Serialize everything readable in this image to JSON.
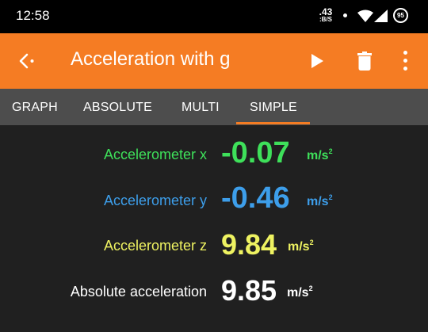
{
  "status_bar": {
    "time": "12:58",
    "net_speed_value": ".43",
    "net_speed_unit": ":B/S",
    "battery_level": "95",
    "icons": [
      "notification-dot-icon",
      "wifi-icon",
      "cell-signal-icon",
      "battery-icon"
    ]
  },
  "app_bar": {
    "title": "Acceleration with g",
    "background_color": "#f57c23",
    "icons": [
      "back-icon",
      "play-icon",
      "delete-icon",
      "more-options-icon"
    ]
  },
  "tabs": {
    "items": [
      "GRAPH",
      "ABSOLUTE",
      "MULTI",
      "SIMPLE"
    ],
    "selected": "SIMPLE",
    "indicator_color": "#f57c23"
  },
  "readings": [
    {
      "label": "Accelerometer x",
      "value": "-0.07",
      "unit": "m/s",
      "unit_exponent": "2",
      "color": "#3ee05a"
    },
    {
      "label": "Accelerometer y",
      "value": "-0.46",
      "unit": "m/s",
      "unit_exponent": "2",
      "color": "#3d9eea"
    },
    {
      "label": "Accelerometer z",
      "value": "9.84",
      "unit": "m/s",
      "unit_exponent": "2",
      "color": "#eef261"
    },
    {
      "label": "Absolute acceleration",
      "value": "9.85",
      "unit": "m/s",
      "unit_exponent": "2",
      "color": "#ffffff"
    }
  ]
}
